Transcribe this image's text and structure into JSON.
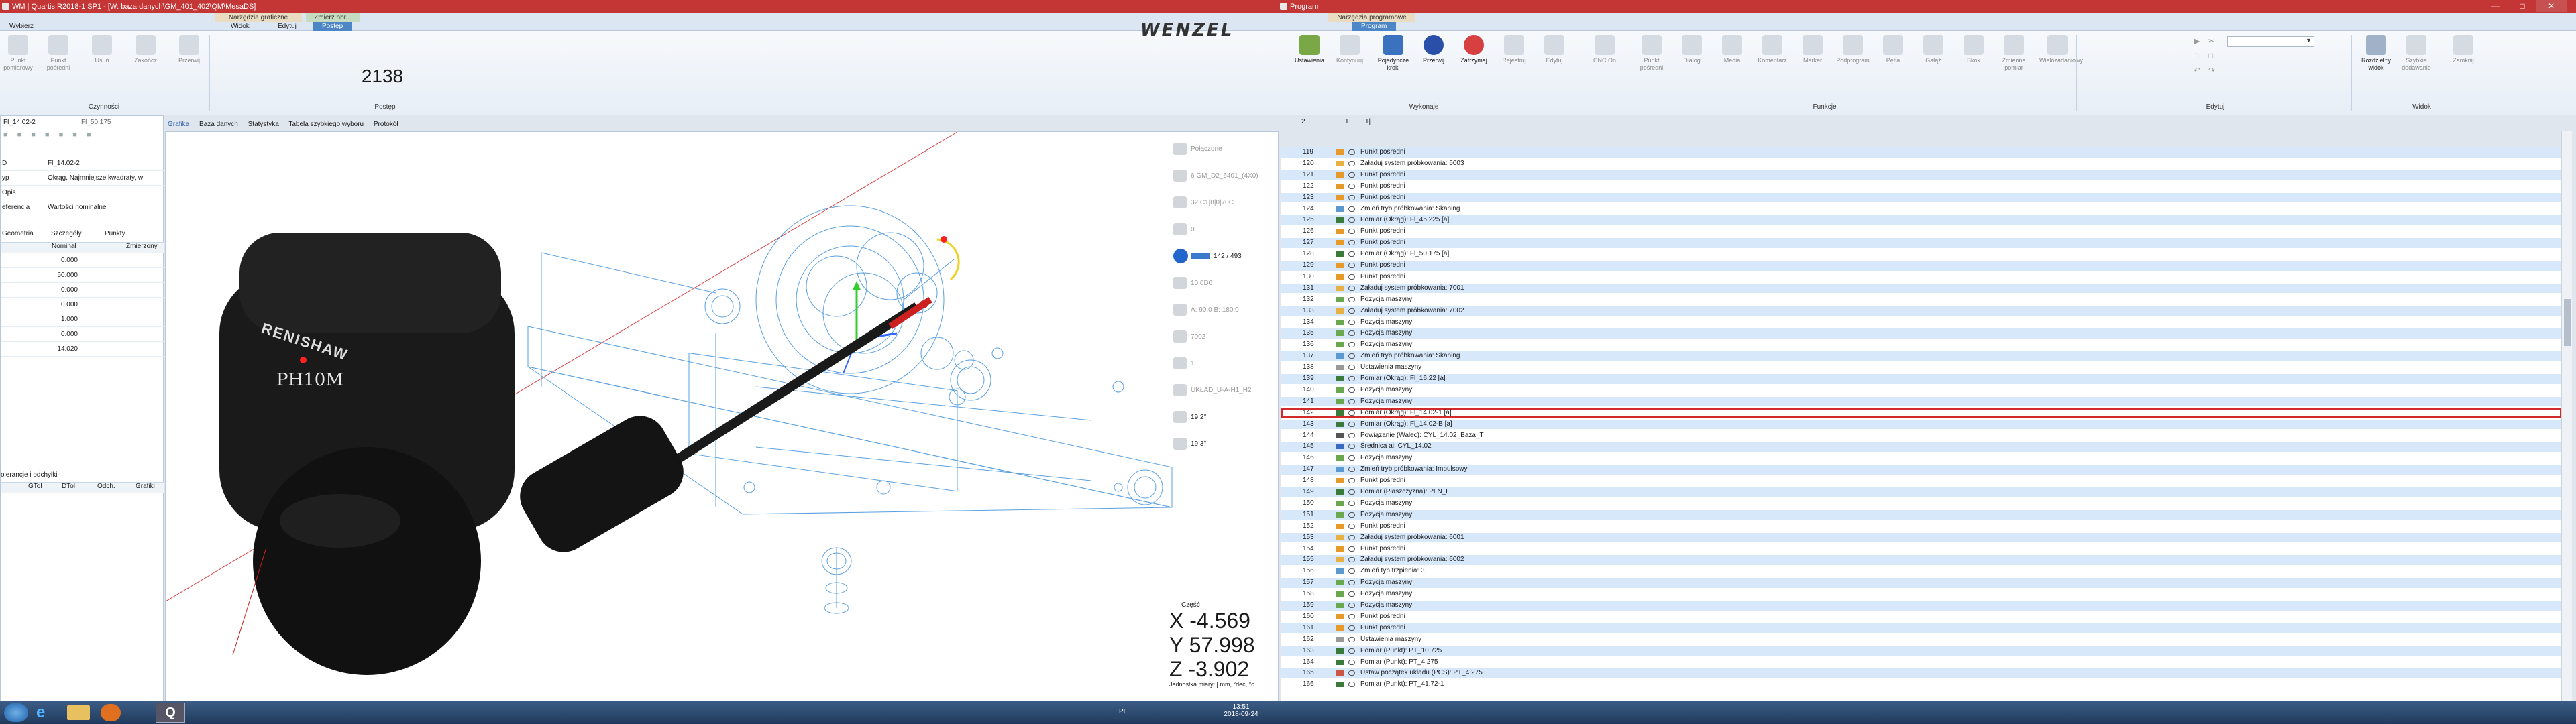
{
  "left_window": {
    "title": "WM | Quartis  R2018-1 SP1 - [W: baza danych\\GM_401_402\\QM\\MesaDS]",
    "ribbon": {
      "context_groups": [
        "Narzędzia graficzne",
        "Zmierz obr..."
      ],
      "tabs": [
        "Wybierz",
        "Widok",
        "Edytuj",
        "Postęp"
      ],
      "active_tab": "Postęp",
      "buttons": [
        {
          "label": "Punkt pomiarowy",
          "icon": "point-icon"
        },
        {
          "label": "Punkt pośredni",
          "icon": "via-point-icon"
        },
        {
          "label": "Usuń",
          "icon": "delete-icon"
        },
        {
          "label": "Zakończ",
          "icon": "finish-icon"
        },
        {
          "label": "Przerwij",
          "icon": "abort-icon"
        }
      ],
      "group_czynnosci": "Czynności",
      "progress_value": "2138",
      "group_postep": "Postęp"
    },
    "panel": {
      "feature_tabs": [
        "Fl_14.02-2",
        "Fl_50.175"
      ],
      "properties": [
        {
          "key": "D",
          "value": "Fl_14.02-2"
        },
        {
          "key": "yp",
          "value": "Okrąg, Najmniejsze kwadraty, w"
        },
        {
          "key": "Opis",
          "value": ""
        },
        {
          "key": "eferencja",
          "value": "Wartości nominalne"
        }
      ],
      "detail_tabs": [
        "Geometria",
        "Szczegóły",
        "Punkty"
      ],
      "table_headers": [
        "Nominał",
        "Zmierzony"
      ],
      "nominal_values": [
        "0.000",
        "50.000",
        "0.000",
        "0.000",
        "1.000",
        "0.000",
        "14.020"
      ],
      "tolerance_title": "olerancje i odchyłki",
      "tolerance_headers": [
        "GTol",
        "DTol",
        "Odch.",
        "Grafiki"
      ]
    },
    "view_tabs": [
      "Grafika",
      "Baza danych",
      "Statystyka",
      "Tabela szybkiego wyboru",
      "Protokół"
    ],
    "probe": {
      "brand": "RENISHAW",
      "model": "PH10M"
    },
    "status_items": [
      {
        "label": "Połączone",
        "icon": "connection-icon"
      },
      {
        "label": "6 GM_D2_6401_(4X0)",
        "icon": "probe-icon"
      },
      {
        "label": "32 C1|8|0|70C",
        "icon": "tip-icon"
      },
      {
        "label": "0",
        "icon": "count-icon"
      },
      {
        "label": "142 / 493",
        "icon": "play-icon"
      },
      {
        "label": "10.0D0",
        "icon": "speed-icon"
      },
      {
        "label": "A: 90.0 B: 180.0",
        "icon": "angle-icon"
      },
      {
        "label": "7002",
        "icon": "system-icon"
      },
      {
        "label": "1",
        "icon": "step-icon"
      },
      {
        "label": "UKŁAD_U-A-H1_H2",
        "icon": "coord-icon"
      },
      {
        "label": "19.2°",
        "icon": "temp-icon"
      },
      {
        "label": "19.3°",
        "icon": "temp-icon-2"
      }
    ],
    "coords": {
      "part_label": "Część",
      "x_label": "X",
      "x": "-4.569",
      "y_label": "Y",
      "y": "57.998",
      "z_label": "Z",
      "z": "-3.902",
      "units": "Jednostka miary: [.mm, °dec, °c"
    }
  },
  "brand_logo": "WENZEL",
  "right_window": {
    "title": "Program",
    "context_group": "Narzędzia programowe",
    "active_tab": "Program",
    "buttons": [
      {
        "label": "Ustawienia",
        "icon": "settings-icon",
        "on": true
      },
      {
        "label": "Kontynuuj",
        "icon": "continue-icon",
        "on": false
      },
      {
        "label": "Pojedyncze kroki",
        "icon": "single-step-icon",
        "on": true
      },
      {
        "label": "Przerwij",
        "icon": "pause-icon",
        "on": true
      },
      {
        "label": "Zatrzymaj",
        "icon": "stop-icon",
        "on": true
      },
      {
        "label": "Rejestruj",
        "icon": "record-icon",
        "on": false
      },
      {
        "label": "Edytuj",
        "icon": "edit-icon",
        "on": false
      },
      {
        "label": "CNC On",
        "icon": "cnc-icon",
        "on": false
      },
      {
        "label": "Punkt pośredni",
        "icon": "via-icon",
        "on": false
      },
      {
        "label": "Dialog",
        "icon": "dialog-icon",
        "on": false
      },
      {
        "label": "Media",
        "icon": "media-icon",
        "on": false
      },
      {
        "label": "Komentarz",
        "icon": "comment-icon",
        "on": false
      },
      {
        "label": "Marker",
        "icon": "marker-icon",
        "on": false
      },
      {
        "label": "Podprogram",
        "icon": "subprogram-icon",
        "on": false
      },
      {
        "label": "Pętla",
        "icon": "loop-icon",
        "on": false
      },
      {
        "label": "Gałąź",
        "icon": "branch-icon",
        "on": false
      },
      {
        "label": "Skok",
        "icon": "jump-icon",
        "on": false
      },
      {
        "label": "Zmienne pomiar",
        "icon": "variable-icon",
        "on": false
      },
      {
        "label": "Wielozadaniowy",
        "icon": "multi-icon",
        "on": false
      },
      {
        "label": "Rozdzielny widok",
        "icon": "split-view-icon",
        "on": true
      },
      {
        "label": "Szybkie dodawanie",
        "icon": "quick-add-icon",
        "on": false
      },
      {
        "label": "Zamknij",
        "icon": "close-view-icon",
        "on": false
      }
    ],
    "groups": [
      "Wykonaje",
      "Funkcje",
      "Edytuj",
      "Widok"
    ],
    "list_toolbar": [
      "2",
      "1",
      "1|"
    ],
    "rows": [
      {
        "n": "119",
        "t": "Punkt pośredni"
      },
      {
        "n": "120",
        "t": "Załaduj system próbkowania: 5003"
      },
      {
        "n": "121",
        "t": "Punkt pośredni"
      },
      {
        "n": "122",
        "t": "Punkt pośredni"
      },
      {
        "n": "123",
        "t": "Punkt pośredni"
      },
      {
        "n": "124",
        "t": "Zmień tryb próbkowania: Skaning"
      },
      {
        "n": "125",
        "t": "Pomiar (Okrąg): Fl_45.225 [a]"
      },
      {
        "n": "126",
        "t": "Punkt pośredni"
      },
      {
        "n": "127",
        "t": "Punkt pośredni"
      },
      {
        "n": "128",
        "t": "Pomiar (Okrąg): Fl_50.175 [a]"
      },
      {
        "n": "129",
        "t": "Punkt pośredni"
      },
      {
        "n": "130",
        "t": "Punkt pośredni"
      },
      {
        "n": "131",
        "t": "Załaduj system próbkowania: 7001"
      },
      {
        "n": "132",
        "t": "Pozycja maszyny"
      },
      {
        "n": "133",
        "t": "Załaduj system próbkowania: 7002"
      },
      {
        "n": "134",
        "t": "Pozycja maszyny"
      },
      {
        "n": "135",
        "t": "Pozycja maszyny"
      },
      {
        "n": "136",
        "t": "Pozycja maszyny"
      },
      {
        "n": "137",
        "t": "Zmień tryb próbkowania: Skaning"
      },
      {
        "n": "138",
        "t": "Ustawienia maszyny"
      },
      {
        "n": "139",
        "t": "Pomiar (Okrąg): Fl_16.22 [a]"
      },
      {
        "n": "140",
        "t": "Pozycja maszyny"
      },
      {
        "n": "141",
        "t": "Pozycja maszyny"
      },
      {
        "n": "142",
        "t": "Pomiar (Okrąg): Fl_14.02-1 [a]"
      },
      {
        "n": "143",
        "t": "Pomiar (Okrąg): Fl_14.02-B [a]"
      },
      {
        "n": "144",
        "t": "Powiązanie (Walec): CYL_14.02_Baza_T"
      },
      {
        "n": "145",
        "t": "Średnica ai: CYL_14.02"
      },
      {
        "n": "146",
        "t": "Pozycja maszyny"
      },
      {
        "n": "147",
        "t": "Zmień tryb próbkowania: Impulsowy"
      },
      {
        "n": "148",
        "t": "Punkt pośredni"
      },
      {
        "n": "149",
        "t": "Pomiar (Płaszczyzna): PLN_L"
      },
      {
        "n": "150",
        "t": "Pozycja maszyny"
      },
      {
        "n": "151",
        "t": "Pozycja maszyny"
      },
      {
        "n": "152",
        "t": "Punkt pośredni"
      },
      {
        "n": "153",
        "t": "Załaduj system próbkowania: 6001"
      },
      {
        "n": "154",
        "t": "Punkt pośredni"
      },
      {
        "n": "155",
        "t": "Załaduj system próbkowania: 6002"
      },
      {
        "n": "156",
        "t": "Zmień typ trzpienia: 3"
      },
      {
        "n": "157",
        "t": "Pozycja maszyny"
      },
      {
        "n": "158",
        "t": "Pozycja maszyny"
      },
      {
        "n": "159",
        "t": "Pozycja maszyny"
      },
      {
        "n": "160",
        "t": "Punkt pośredni"
      },
      {
        "n": "161",
        "t": "Punkt pośredni"
      },
      {
        "n": "162",
        "t": "Ustawienia maszyny"
      },
      {
        "n": "163",
        "t": "Pomiar (Punkt): PT_10.725"
      },
      {
        "n": "164",
        "t": "Pomiar (Punkt): PT_4.275"
      },
      {
        "n": "165",
        "t": "Ustaw początek układu (PCS): PT_4.275"
      },
      {
        "n": "166",
        "t": "Pomiar (Punkt): PT_41.72-1"
      }
    ],
    "selected_row": "142"
  },
  "taskbar": {
    "lang": "PL",
    "time": "13:51",
    "date": "2018-09-24"
  },
  "colors": {
    "titlebar": "#c43636",
    "accent": "#4d86c6",
    "row_alt": "#d7e8fb",
    "selection": "#d22a2a",
    "probe_body": "#111111"
  }
}
